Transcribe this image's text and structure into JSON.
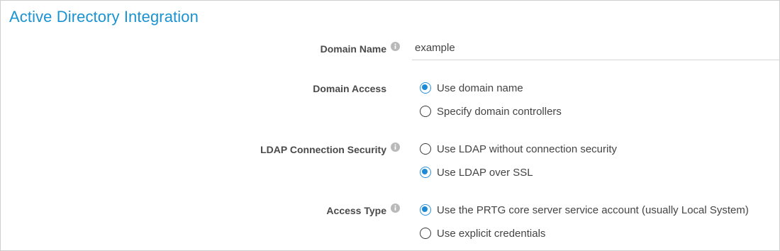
{
  "section": {
    "title": "Active Directory Integration"
  },
  "colors": {
    "title": "#1b93d1",
    "radio_selected": "#1c8ad6",
    "label": "#4a4a4a",
    "border": "#cfcfcf"
  },
  "fields": {
    "domain_name": {
      "label": "Domain Name",
      "value": "example",
      "icon": "info-icon"
    },
    "domain_access": {
      "label": "Domain Access",
      "options": [
        {
          "label": "Use domain name",
          "selected": true
        },
        {
          "label": "Specify domain controllers",
          "selected": false
        }
      ]
    },
    "ldap_security": {
      "label": "LDAP Connection Security",
      "icon": "info-icon",
      "options": [
        {
          "label": "Use LDAP without connection security",
          "selected": false
        },
        {
          "label": "Use LDAP over SSL",
          "selected": true
        }
      ]
    },
    "access_type": {
      "label": "Access Type",
      "icon": "info-icon",
      "options": [
        {
          "label": "Use the PRTG core server service account (usually Local System)",
          "selected": true
        },
        {
          "label": "Use explicit credentials",
          "selected": false
        }
      ]
    }
  }
}
